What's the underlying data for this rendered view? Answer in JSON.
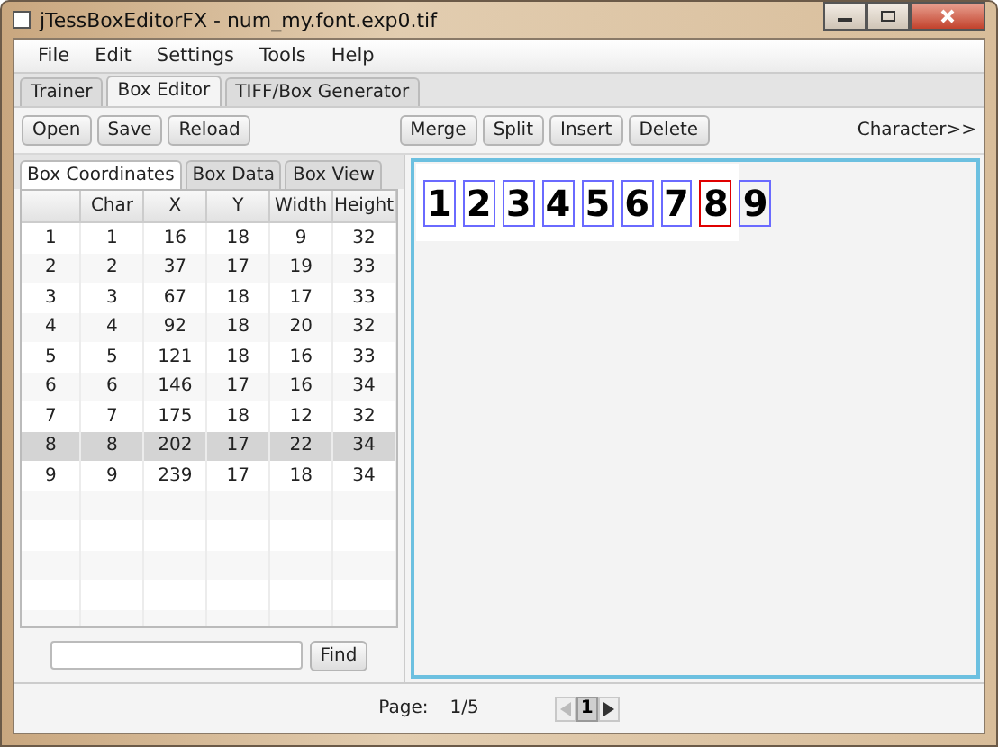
{
  "window": {
    "title": "jTessBoxEditorFX - num_my.font.exp0.tif"
  },
  "menu": [
    "File",
    "Edit",
    "Settings",
    "Tools",
    "Help"
  ],
  "tabs": [
    {
      "label": "Trainer",
      "selected": false
    },
    {
      "label": "Box Editor",
      "selected": true
    },
    {
      "label": "TIFF/Box Generator",
      "selected": false
    }
  ],
  "toolbar": {
    "left": [
      "Open",
      "Save",
      "Reload"
    ],
    "center": [
      "Merge",
      "Split",
      "Insert",
      "Delete"
    ],
    "right": "Character>>"
  },
  "subtabs": [
    {
      "label": "Box Coordinates",
      "selected": true
    },
    {
      "label": "Box Data",
      "selected": false
    },
    {
      "label": "Box View",
      "selected": false
    }
  ],
  "table": {
    "columns": [
      "Char",
      "X",
      "Y",
      "Width",
      "Height"
    ],
    "rows": [
      {
        "index": "1",
        "cells": [
          "1",
          "16",
          "18",
          "9",
          "32"
        ],
        "selected": false
      },
      {
        "index": "2",
        "cells": [
          "2",
          "37",
          "17",
          "19",
          "33"
        ],
        "selected": false
      },
      {
        "index": "3",
        "cells": [
          "3",
          "67",
          "18",
          "17",
          "33"
        ],
        "selected": false
      },
      {
        "index": "4",
        "cells": [
          "4",
          "92",
          "18",
          "20",
          "32"
        ],
        "selected": false
      },
      {
        "index": "5",
        "cells": [
          "5",
          "121",
          "18",
          "16",
          "33"
        ],
        "selected": false
      },
      {
        "index": "6",
        "cells": [
          "6",
          "146",
          "17",
          "16",
          "34"
        ],
        "selected": false
      },
      {
        "index": "7",
        "cells": [
          "7",
          "175",
          "18",
          "12",
          "32"
        ],
        "selected": false
      },
      {
        "index": "8",
        "cells": [
          "8",
          "202",
          "17",
          "22",
          "34"
        ],
        "selected": true
      },
      {
        "index": "9",
        "cells": [
          "9",
          "239",
          "17",
          "18",
          "34"
        ],
        "selected": false
      }
    ]
  },
  "image": {
    "glyphs": [
      {
        "char": "1",
        "selected": false
      },
      {
        "char": "2",
        "selected": false
      },
      {
        "char": "3",
        "selected": false
      },
      {
        "char": "4",
        "selected": false
      },
      {
        "char": "5",
        "selected": false
      },
      {
        "char": "6",
        "selected": false
      },
      {
        "char": "7",
        "selected": false
      },
      {
        "char": "8",
        "selected": true
      },
      {
        "char": "9",
        "selected": false
      }
    ]
  },
  "find": {
    "button": "Find"
  },
  "pager": {
    "label": "Page:",
    "value": "1/5",
    "prev_enabled": false,
    "next_enabled": true,
    "pages": [
      {
        "label": "1",
        "selected": true
      }
    ]
  }
}
